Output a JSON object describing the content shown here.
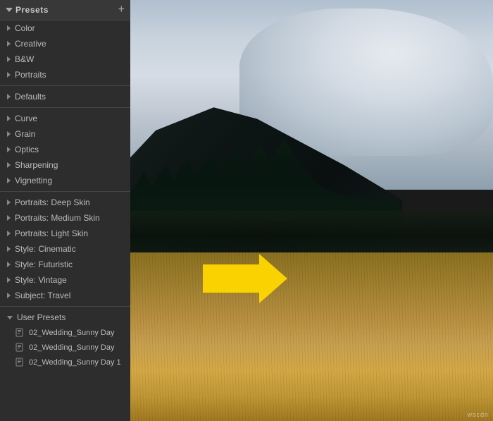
{
  "sidebar": {
    "title": "Presets",
    "add_label": "+",
    "groups": [
      {
        "id": "color",
        "label": "Color",
        "expanded": false,
        "type": "group"
      },
      {
        "id": "creative",
        "label": "Creative",
        "expanded": false,
        "type": "group"
      },
      {
        "id": "bw",
        "label": "B&W",
        "expanded": false,
        "type": "group"
      },
      {
        "id": "portraits",
        "label": "Portraits",
        "expanded": false,
        "type": "group"
      },
      {
        "id": "divider1",
        "type": "divider"
      },
      {
        "id": "defaults",
        "label": "Defaults",
        "expanded": false,
        "type": "group"
      },
      {
        "id": "divider2",
        "type": "divider"
      },
      {
        "id": "curve",
        "label": "Curve",
        "expanded": false,
        "type": "group"
      },
      {
        "id": "grain",
        "label": "Grain",
        "expanded": false,
        "type": "group"
      },
      {
        "id": "optics",
        "label": "Optics",
        "expanded": false,
        "type": "group"
      },
      {
        "id": "sharpening",
        "label": "Sharpening",
        "expanded": false,
        "type": "group"
      },
      {
        "id": "vignetting",
        "label": "Vignetting",
        "expanded": false,
        "type": "group"
      },
      {
        "id": "divider3",
        "type": "divider"
      },
      {
        "id": "portraits-deep",
        "label": "Portraits: Deep Skin",
        "expanded": false,
        "type": "group"
      },
      {
        "id": "portraits-medium",
        "label": "Portraits: Medium Skin",
        "expanded": false,
        "type": "group"
      },
      {
        "id": "portraits-light",
        "label": "Portraits: Light Skin",
        "expanded": false,
        "type": "group"
      },
      {
        "id": "style-cinematic",
        "label": "Style: Cinematic",
        "expanded": false,
        "type": "group"
      },
      {
        "id": "style-futuristic",
        "label": "Style: Futuristic",
        "expanded": false,
        "type": "group"
      },
      {
        "id": "style-vintage",
        "label": "Style: Vintage",
        "expanded": false,
        "type": "group"
      },
      {
        "id": "subject-travel",
        "label": "Subject: Travel",
        "expanded": false,
        "type": "group"
      },
      {
        "id": "divider4",
        "type": "divider"
      },
      {
        "id": "user-presets",
        "label": "User Presets",
        "expanded": true,
        "type": "group-expanded"
      }
    ],
    "user_preset_items": [
      {
        "id": "up1",
        "label": "02_Wedding_Sunny Day"
      },
      {
        "id": "up2",
        "label": "02_Wedding_Sunny Day"
      },
      {
        "id": "up3",
        "label": "02_Wedding_Sunny Day 1"
      }
    ]
  },
  "watermark": "watermark"
}
